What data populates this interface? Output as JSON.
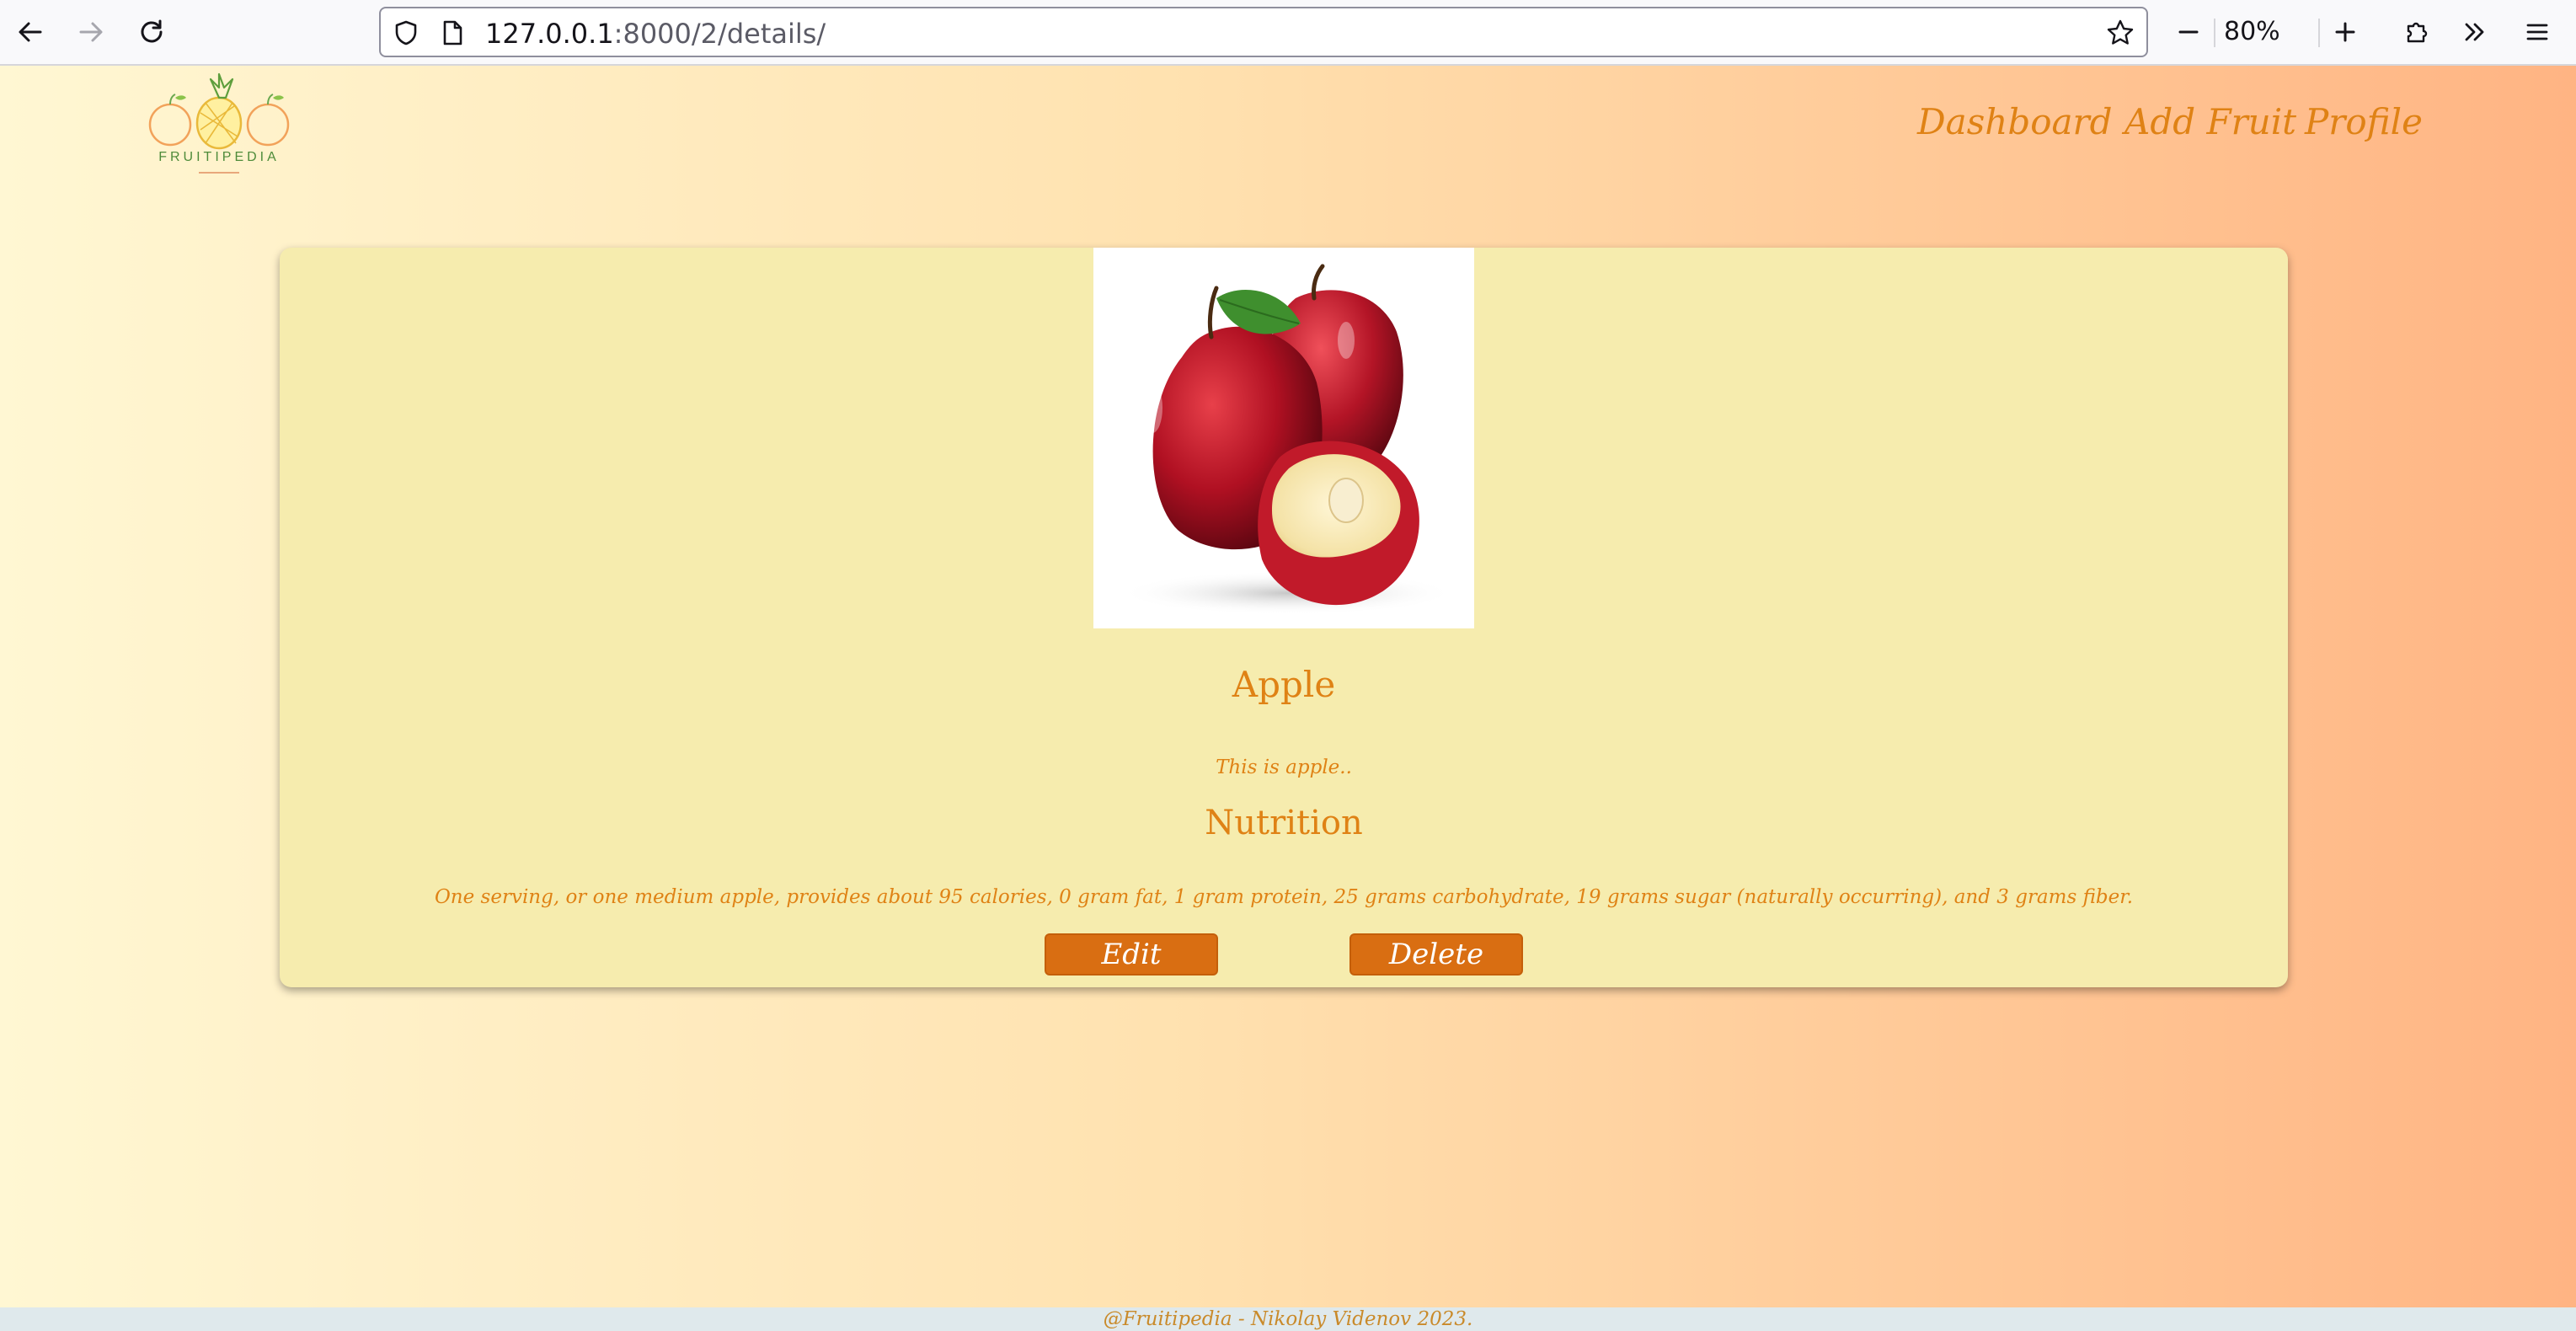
{
  "browser": {
    "url_host": "127.0.0.1",
    "url_rest": ":8000/2/details/",
    "zoom": "80%"
  },
  "logo": {
    "text": "FRUITIPEDIA"
  },
  "nav": {
    "items": [
      {
        "label": "Dashboard"
      },
      {
        "label": "Add Fruit"
      },
      {
        "label": "Profile"
      }
    ]
  },
  "fruit": {
    "name": "Apple",
    "description": "This is apple..",
    "nutrition_heading": "Nutrition",
    "nutrition": "One serving, or one medium apple, provides about 95 calories, 0 gram fat, 1 gram protein, 25 grams carbohydrate, 19 grams sugar (naturally occurring), and 3 grams fiber."
  },
  "actions": {
    "edit_label": "Edit",
    "delete_label": "Delete"
  },
  "footer": {
    "text": "@Fruitipedia - Nikolay Videnov 2023."
  },
  "colors": {
    "accent": "#df8215",
    "button": "#d96e12",
    "card": "#f6ecae"
  }
}
